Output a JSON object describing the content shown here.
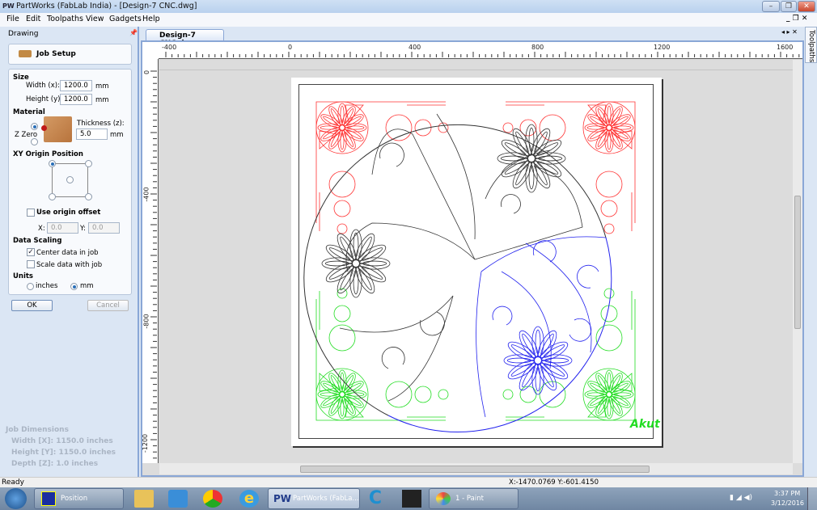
{
  "window": {
    "logo": "PW",
    "title": "PartWorks (FabLab India) - [Design-7 CNC.dwg]"
  },
  "menu": [
    "File",
    "Edit",
    "Toolpaths",
    "View",
    "Gadgets",
    "Help"
  ],
  "panel": {
    "header": "Drawing",
    "job_setup": "Job Setup",
    "size": {
      "heading": "Size",
      "width_label": "Width (x):",
      "width_value": "1200.0",
      "height_label": "Height (y):",
      "height_value": "1200.0",
      "unit": "mm"
    },
    "material": {
      "heading": "Material",
      "z_zero": "Z Zero",
      "thickness_label": "Thickness (z):",
      "thickness_value": "5.0",
      "unit": "mm",
      "z_zero_top_selected": true
    },
    "xy_origin": {
      "heading": "XY Origin Position",
      "selected": "top-left"
    },
    "origin_offset": {
      "label": "Use origin offset",
      "checked": false,
      "x_label": "X:",
      "x_value": "0.0",
      "y_label": "Y:",
      "y_value": "0.0"
    },
    "data_scaling": {
      "heading": "Data Scaling",
      "center": "Center data in job",
      "center_checked": true,
      "scale": "Scale data with job",
      "scale_checked": false
    },
    "units": {
      "heading": "Units",
      "inches": "inches",
      "mm": "mm",
      "selected": "mm"
    },
    "ok": "OK",
    "cancel": "Cancel",
    "job_dimensions": {
      "heading": "Job Dimensions",
      "width": "Width  [X]: 1150.0 inches",
      "height": "Height [Y]: 1150.0 inches",
      "depth": "Depth  [Z]: 1.0 inches"
    }
  },
  "document": {
    "tab": "Design-7 CNC.dwg",
    "side_tab": "Toolpaths",
    "hruler": [
      "-400",
      "0",
      "400",
      "800",
      "1200",
      "1600"
    ],
    "vruler": [
      "0",
      "-400",
      "-800",
      "-1200"
    ],
    "signature": "Akut",
    "colors": {
      "top_corners": "#ff3333",
      "bottom_corners": "#22dd22",
      "blue_segment": "#2222ee",
      "black": "#333333"
    }
  },
  "status": {
    "left": "Ready",
    "coords": "X:-1470.0769 Y:-601.4150"
  },
  "taskbar": {
    "position": "Position",
    "partworks": "PartWorks (FabLa...",
    "paint": "1 - Paint",
    "time": "3:37 PM",
    "date": "3/12/2016"
  }
}
